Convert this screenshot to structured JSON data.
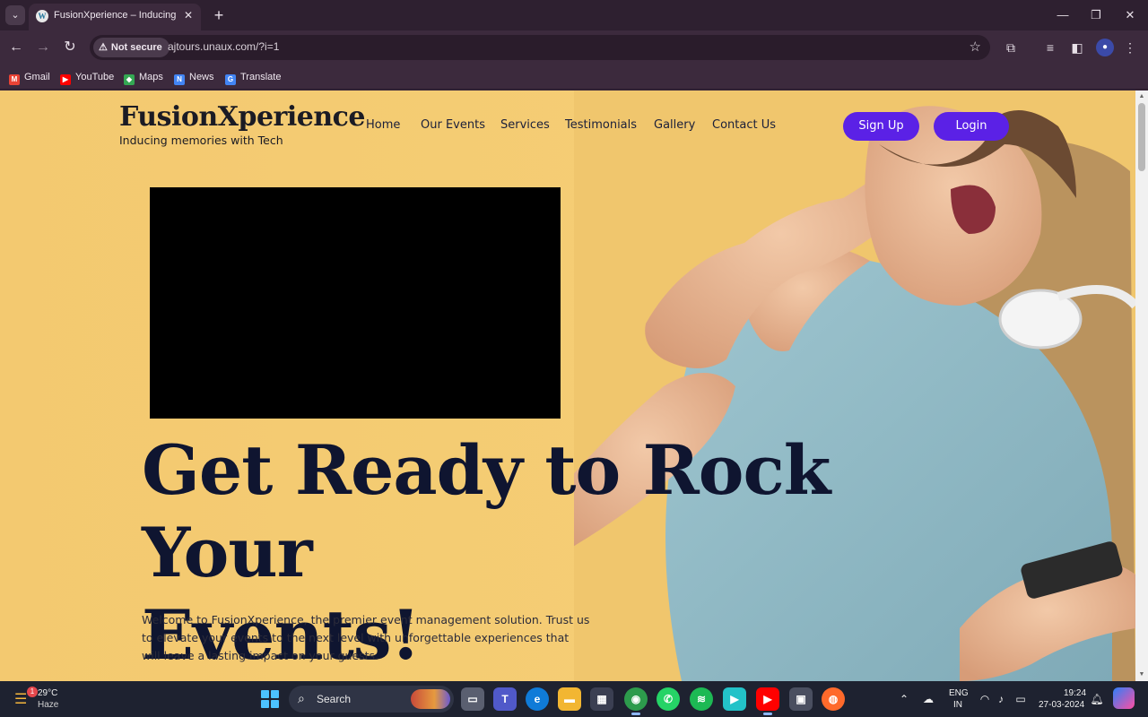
{
  "browser": {
    "tab": {
      "title": "FusionXperience – Inducing me",
      "favicon": "wordpress-icon"
    },
    "security_label": "Not secure",
    "url": "ajtours.unaux.com/?i=1",
    "bookmarks": [
      {
        "label": "Gmail",
        "icon": "gmail-icon",
        "color": "#ea4335"
      },
      {
        "label": "YouTube",
        "icon": "youtube-icon",
        "color": "#ff0000"
      },
      {
        "label": "Maps",
        "icon": "maps-icon",
        "color": "#34a853"
      },
      {
        "label": "News",
        "icon": "news-icon",
        "color": "#4285f4"
      },
      {
        "label": "Translate",
        "icon": "translate-icon",
        "color": "#4285f4"
      }
    ]
  },
  "site": {
    "brand": {
      "name": "FusionXperience",
      "tagline": "Inducing memories with Tech"
    },
    "nav": [
      "Home",
      "Our Events",
      "Services",
      "Testimonials",
      "Gallery",
      "Contact Us"
    ],
    "signup_label": "Sign Up",
    "login_label": "Login",
    "headline_line1": "Get Ready to Rock Your",
    "headline_line2": "Events!",
    "intro": "Welcome to FusionXperience, the premier event management solution. Trust us to elevate your events to the next level with unforgettable experiences that will leave a lasting impact on your guests.",
    "accent_color": "#5b21e6",
    "hero_background": "#f3c970"
  },
  "taskbar": {
    "weather": {
      "temp": "29°C",
      "condition": "Haze",
      "badge": "1"
    },
    "search_label": "Search",
    "lang_top": "ENG",
    "lang_bottom": "IN",
    "time": "19:24",
    "date": "27-03-2024"
  }
}
